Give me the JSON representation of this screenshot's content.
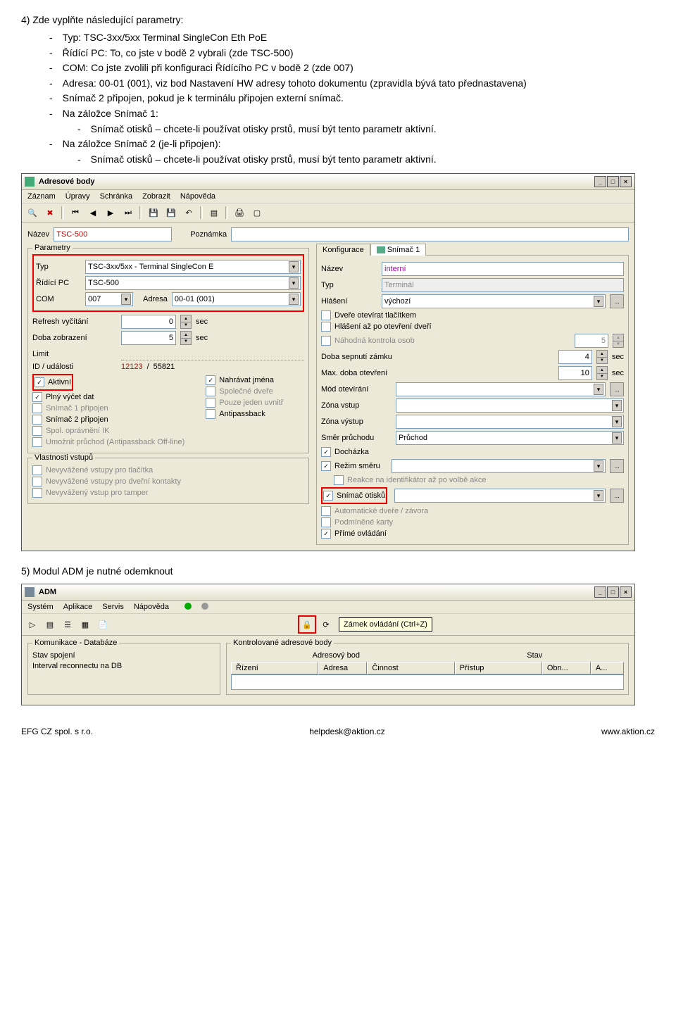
{
  "step4": {
    "num": "4)",
    "title": "Zde vyplňte následující parametry:",
    "items": [
      "Typ: TSC-3xx/5xx Terminal SingleCon Eth PoE",
      "Řídící PC: To, co jste v bodě 2 vybrali (zde TSC-500)",
      "COM: Co jste zvolili při konfiguraci Řídícího PC v bodě 2 (zde 007)",
      "Adresa: 00-01 (001), viz bod Nastavení HW adresy tohoto dokumentu (zpravidla bývá tato přednastavena)",
      "Snímač 2 připojen, pokud je k terminálu připojen externí snímač.",
      "Na záložce Snímač 1:",
      "Na záložce Snímač 2 (je-li připojen):"
    ],
    "sub1": "Snímač otisků – chcete-li používat otisky prstů, musí být tento parametr aktivní.",
    "sub2": "Snímač otisků – chcete-li používat otisky prstů, musí být tento parametr aktivní."
  },
  "win1": {
    "title": "Adresové body",
    "menu": [
      "Záznam",
      "Úpravy",
      "Schránka",
      "Zobrazit",
      "Nápověda"
    ],
    "nazev_lbl": "Název",
    "nazev_val": "TSC-500",
    "pozn_lbl": "Poznámka",
    "params": {
      "title": "Parametry",
      "typ_lbl": "Typ",
      "typ_val": "TSC-3xx/5xx - Terminal SingleCon E",
      "pc_lbl": "Řídící PC",
      "pc_val": "TSC-500",
      "com_lbl": "COM",
      "com_val": "007",
      "adr_lbl": "Adresa",
      "adr_val": "00-01 (001)",
      "refresh_lbl": "Refresh vyčítání",
      "refresh_val": "0",
      "sec": "sec",
      "doba_lbl": "Doba zobrazení",
      "doba_val": "5",
      "limit_lbl": "Limit",
      "id_lbl": "ID / události",
      "id_val": "12123",
      "id_sep": " / ",
      "id_val2": "55821",
      "chk_aktivni": "Aktivní",
      "chk_plny": "Plný výčet dat",
      "chk_s1": "Snímač 1 připojen",
      "chk_s2": "Snímač 2 připojen",
      "chk_spol": "Spol. oprávnění IK",
      "chk_umoz": "Umožnit průchod (Antipassback Off-line)",
      "chk_nahr": "Nahrávat jména",
      "chk_spdv": "Společné dveře",
      "chk_pouze": "Pouze jeden uvnitř",
      "chk_anti": "Antipassback"
    },
    "vlast": {
      "title": "Vlastnosti vstupů",
      "a": "Nevyvážené vstupy pro tlačítka",
      "b": "Nevyvážené vstupy pro dveřní kontakty",
      "c": "Nevyvážený vstup pro tamper"
    },
    "tabs": {
      "konf": "Konfigurace",
      "sn1": "Snímač 1"
    },
    "right": {
      "nazev_lbl": "Název",
      "nazev_val": "interní",
      "typ_lbl": "Typ",
      "typ_val": "Terminál",
      "hlas_lbl": "Hlášení",
      "hlas_val": "výchozí",
      "dvere": "Dveře otevírat tlačítkem",
      "hlaseni": "Hlášení až po otevření dveří",
      "nahod": "Náhodná kontrola osob",
      "nahod_val": "5",
      "sepnuti_lbl": "Doba sepnutí zámku",
      "sepnuti_val": "4",
      "maxot_lbl": "Max. doba otevření",
      "maxot_val": "10",
      "modot_lbl": "Mód otevírání",
      "zvstup_lbl": "Zóna vstup",
      "zvystup_lbl": "Zóna výstup",
      "smer_lbl": "Směr průchodu",
      "smer_val": "Průchod",
      "doch": "Docházka",
      "rezim": "Režim směru",
      "reakce": "Reakce na identifikátor až po volbě akce",
      "snotisku": "Snímač otisků",
      "autodv": "Automatické dveře / závora",
      "podm": "Podmíněné karty",
      "prime": "Přímé ovládání"
    }
  },
  "step5": {
    "num": "5)",
    "title": "Modul ADM je nutné odemknout"
  },
  "win2": {
    "title": "ADM",
    "menu": [
      "Systém",
      "Aplikace",
      "Servis",
      "Nápověda"
    ],
    "tooltip": "Zámek ovládání (Ctrl+Z)",
    "kom": {
      "title": "Komunikace - Databáze",
      "stav": "Stav spojení",
      "interval": "Interval reconnectu na DB"
    },
    "kontrol": {
      "title": "Kontrolované adresové body",
      "adr": "Adresový bod",
      "stav": "Stav",
      "cols": [
        "Řízení",
        "Adresa",
        "Činnost",
        "Přístup",
        "Obn...",
        "A..."
      ]
    }
  },
  "footer": {
    "left": "EFG CZ spol. s r.o.",
    "mid": "helpdesk@aktion.cz",
    "right": "www.aktion.cz"
  }
}
